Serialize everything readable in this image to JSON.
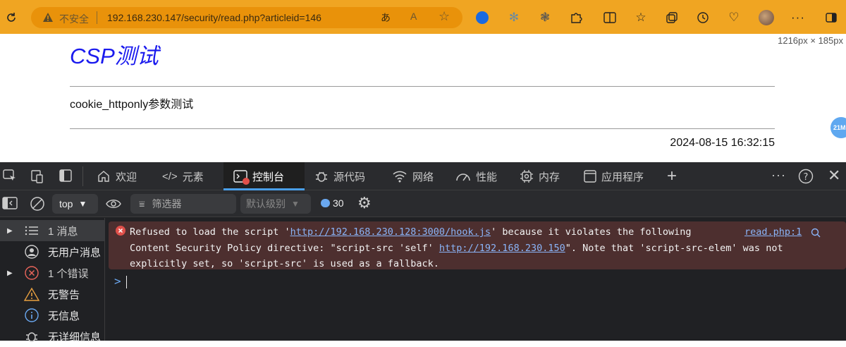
{
  "browser": {
    "security_label": "不安全",
    "url": "192.168.230.147/security/read.php?articleid=146"
  },
  "page": {
    "title": "CSP测试",
    "article_text": "cookie_httponly参数测试",
    "date": "2024-08-15 16:32:15",
    "dimension_badge": "1216px × 185px",
    "side_badge": "21M"
  },
  "devtools": {
    "tabs": [
      {
        "label": "欢迎",
        "icon": "home-icon"
      },
      {
        "label": "元素",
        "icon": "code-brackets-icon"
      },
      {
        "label": "控制台",
        "icon": "console-icon"
      },
      {
        "label": "源代码",
        "icon": "bug-icon"
      },
      {
        "label": "网络",
        "icon": "wifi-icon"
      },
      {
        "label": "性能",
        "icon": "gauge-icon"
      },
      {
        "label": "内存",
        "icon": "chip-icon"
      },
      {
        "label": "应用程序",
        "icon": "window-icon"
      }
    ],
    "filterbar": {
      "context": "top",
      "filter_placeholder": "筛选器",
      "level": "默认级别",
      "message_count": "30"
    },
    "sidebar": [
      {
        "label": "1 消息",
        "icon": "list-icon"
      },
      {
        "label": "无用户消息",
        "icon": "user-icon"
      },
      {
        "label": "1 个错误",
        "icon": "error-circle-icon"
      },
      {
        "label": "无警告",
        "icon": "warning-triangle-icon"
      },
      {
        "label": "无信息",
        "icon": "info-circle-icon"
      },
      {
        "label": "无详细信息",
        "icon": "bug-icon"
      }
    ],
    "console": {
      "error": {
        "line1_a": "Refused to load the script '",
        "line1_link": "http://192.168.230.128:3000/hook.js",
        "line1_b": "' because it violates the following",
        "line2_a": "Content Security Policy directive: \"script-src 'self' ",
        "line2_link": "http://192.168.230.150",
        "line2_b": "\". Note that 'script-src-elem' was not",
        "line3": "explicitly set, so 'script-src' is used as a fallback.",
        "source": "read.php:1"
      },
      "prompt": ">"
    }
  },
  "colors": {
    "toolbar": "#f0a522",
    "address_bar": "#e9920a",
    "title_blue": "#1a1aee",
    "devtools_bg": "#202124",
    "error_bg": "#4d2f2f",
    "link": "#8ab4f8",
    "accent": "#4a9fe8"
  }
}
